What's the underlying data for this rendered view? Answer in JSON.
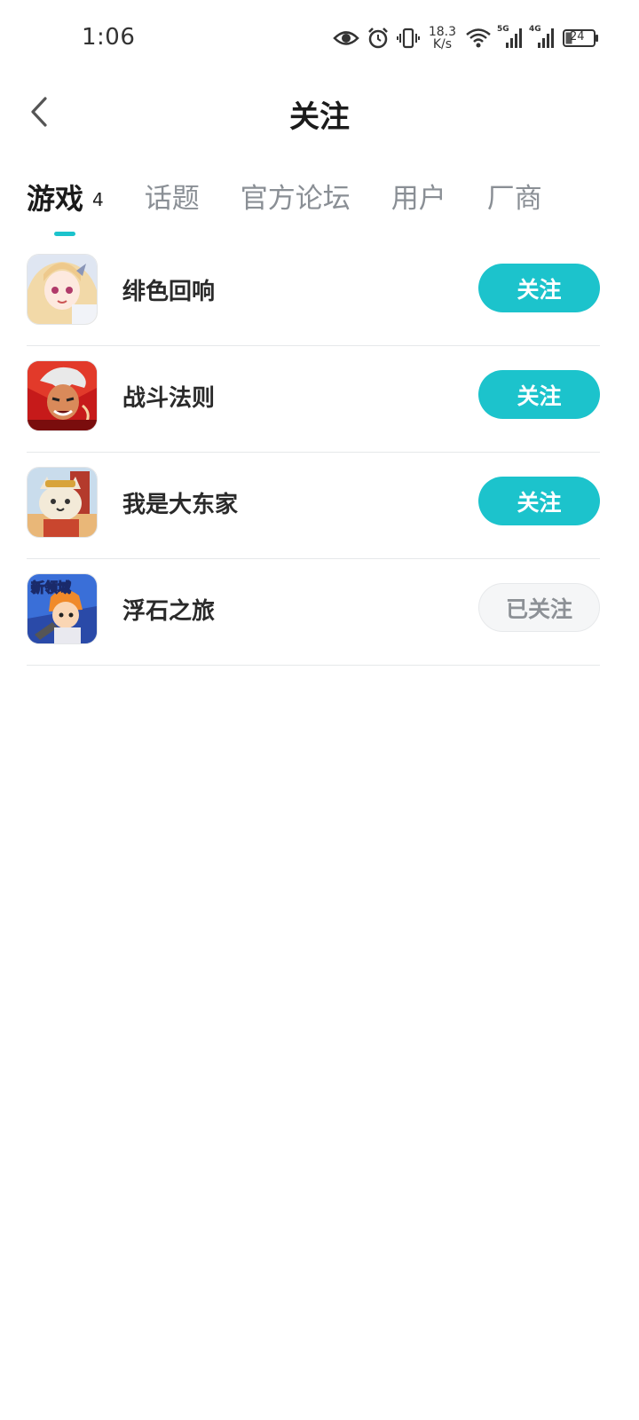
{
  "status_bar": {
    "time": "1:06",
    "speed_value": "18.3",
    "speed_unit": "K/s",
    "sim1_label": "5G",
    "sim2_label": "4G",
    "battery": "24"
  },
  "header": {
    "title": "关注"
  },
  "tabs": [
    {
      "label": "游戏",
      "count": "4",
      "active": true
    },
    {
      "label": "话题"
    },
    {
      "label": "官方论坛"
    },
    {
      "label": "用户"
    },
    {
      "label": "厂商"
    }
  ],
  "games": [
    {
      "name": "绯色回响",
      "button": "关注",
      "followed": false
    },
    {
      "name": "战斗法则",
      "button": "关注",
      "followed": false
    },
    {
      "name": "我是大东家",
      "button": "关注",
      "followed": false
    },
    {
      "name": "浮石之旅",
      "button": "已关注",
      "followed": true,
      "icon_text": "新领域"
    }
  ],
  "colors": {
    "accent": "#1cc3cc",
    "followed_bg": "#f5f6f7",
    "followed_text": "#8d9196"
  }
}
